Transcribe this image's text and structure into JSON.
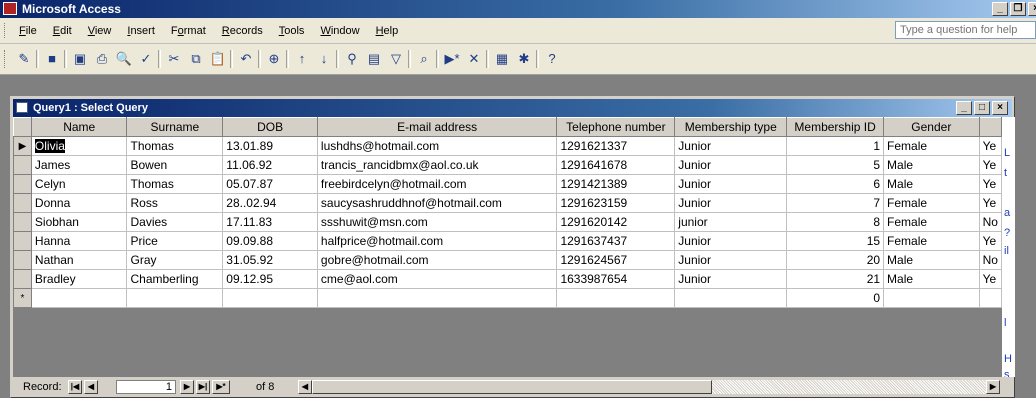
{
  "app": {
    "title": "Microsoft Access",
    "help_placeholder": "Type a question for help"
  },
  "menus": [
    {
      "label": "File",
      "u": "F",
      "rest": "ile"
    },
    {
      "label": "Edit",
      "u": "E",
      "rest": "dit"
    },
    {
      "label": "View",
      "u": "V",
      "rest": "iew"
    },
    {
      "label": "Insert",
      "u": "I",
      "rest": "nsert"
    },
    {
      "label": "Format",
      "pre": "F",
      "u": "o",
      "rest": "rmat"
    },
    {
      "label": "Records",
      "u": "R",
      "rest": "ecords"
    },
    {
      "label": "Tools",
      "u": "T",
      "rest": "ools"
    },
    {
      "label": "Window",
      "u": "W",
      "rest": "indow"
    },
    {
      "label": "Help",
      "u": "H",
      "rest": "elp"
    }
  ],
  "toolbar_icons": [
    "design-view-icon",
    "save-icon",
    "print-preview-toggle-icon",
    "print-icon",
    "print-preview-icon",
    "spelling-icon",
    "cut-icon",
    "copy-icon",
    "paste-icon",
    "undo-icon",
    "hyperlink-icon",
    "sort-ascending-icon",
    "sort-descending-icon",
    "filter-by-selection-icon",
    "filter-by-form-icon",
    "apply-filter-icon",
    "find-icon",
    "new-record-icon",
    "delete-record-icon",
    "database-window-icon",
    "new-object-icon",
    "help-icon"
  ],
  "query_window": {
    "title": "Query1 : Select Query"
  },
  "columns": [
    "Name",
    "Surname",
    "DOB",
    "E-mail address",
    "Telephone number",
    "Membership type",
    "Membership ID",
    "Gender"
  ],
  "rows": [
    {
      "name": "Olivia",
      "surname": "Thomas",
      "dob": "13.01.89",
      "email": "lushdhs@hotmail.com",
      "phone": "1291621337",
      "type": "Junior",
      "id": "1",
      "gender": "Female",
      "extra": "Ye"
    },
    {
      "name": "James",
      "surname": "Bowen",
      "dob": "11.06.92",
      "email": "trancis_rancidbmx@aol.co.uk",
      "phone": "1291641678",
      "type": "Junior",
      "id": "5",
      "gender": "Male",
      "extra": "Ye"
    },
    {
      "name": "Celyn",
      "surname": "Thomas",
      "dob": "05.07.87",
      "email": "freebirdcelyn@hotmail.com",
      "phone": "1291421389",
      "type": "Junior",
      "id": "6",
      "gender": "Male",
      "extra": "Ye"
    },
    {
      "name": "Donna",
      "surname": "Ross",
      "dob": "28..02.94",
      "email": "saucysashruddhnof@hotmail.com",
      "phone": "1291623159",
      "type": "Junior",
      "id": "7",
      "gender": "Female",
      "extra": "Ye"
    },
    {
      "name": "Siobhan",
      "surname": "Davies",
      "dob": "17.11.83",
      "email": "ssshuwit@msn.com",
      "phone": "1291620142",
      "type": "junior",
      "id": "8",
      "gender": "Female",
      "extra": "No"
    },
    {
      "name": "Hanna",
      "surname": "Price",
      "dob": "09.09.88",
      "email": "halfprice@hotmail.com",
      "phone": "1291637437",
      "type": "Junior",
      "id": "15",
      "gender": "Female",
      "extra": "Ye"
    },
    {
      "name": "Nathan",
      "surname": "Gray",
      "dob": "31.05.92",
      "email": "gobre@hotmail.com",
      "phone": "1291624567",
      "type": "Junior",
      "id": "20",
      "gender": "Male",
      "extra": "No"
    },
    {
      "name": "Bradley",
      "surname": "Chamberling",
      "dob": "09.12.95",
      "email": "cme@aol.com",
      "phone": "1633987654",
      "type": "Junior",
      "id": "21",
      "gender": "Male",
      "extra": "Ye"
    }
  ],
  "new_row": {
    "marker": "*",
    "id": "0"
  },
  "status": {
    "record_label": "Record:",
    "current": "1",
    "of_text": "of 8"
  }
}
